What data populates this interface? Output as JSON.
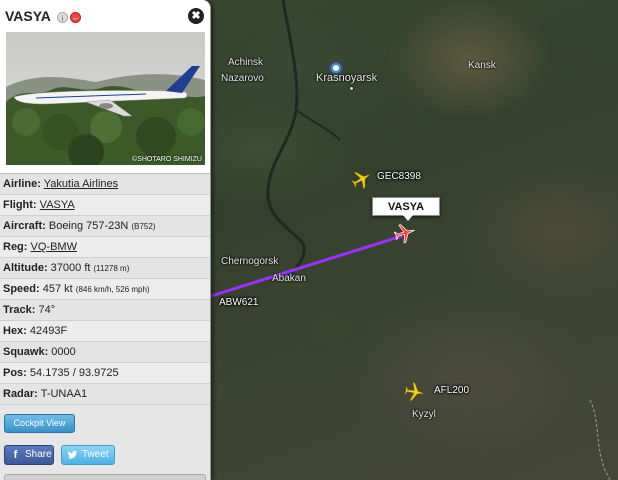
{
  "panel": {
    "title": "VASYA",
    "close_glyph": "✖",
    "info_glyph": "i",
    "remove_glyph": "–",
    "photo_credit": "©SHOTARO SHIMIZU",
    "rows": [
      {
        "label": "Airline:",
        "value": "Yakutia Airlines",
        "sub": "",
        "link": true
      },
      {
        "label": "Flight:",
        "value": "VASYA",
        "sub": "",
        "link": true
      },
      {
        "label": "Aircraft:",
        "value": "Boeing 757-23N",
        "sub": "(B752)",
        "link": false
      },
      {
        "label": "Reg:",
        "value": "VQ-BMW",
        "sub": "",
        "link": true
      },
      {
        "label": "Altitude:",
        "value": "37000 ft",
        "sub": "(11278 m)",
        "link": false
      },
      {
        "label": "Speed:",
        "value": "457 kt",
        "sub": "(846 km/h, 526 mph)",
        "link": false
      },
      {
        "label": "Track:",
        "value": "74°",
        "sub": "",
        "link": false
      },
      {
        "label": "Hex:",
        "value": "42493F",
        "sub": "",
        "link": false
      },
      {
        "label": "Squawk:",
        "value": "0000",
        "sub": "",
        "link": false
      },
      {
        "label": "Pos:",
        "value": "54.1735 / 93.9725",
        "sub": "",
        "link": false
      },
      {
        "label": "Radar:",
        "value": "T-UNAA1",
        "sub": "",
        "link": false
      }
    ],
    "cockpit_label": "Cockpit View",
    "facebook_label": "Share",
    "twitter_label": "Tweet"
  },
  "map": {
    "cities": {
      "achinsk": "Achinsk",
      "nazarovo": "Nazarovo",
      "krasnoyarsk": "Krasnoyarsk",
      "kansk": "Kansk",
      "chernogorsk": "Chernogorsk",
      "abakan": "Abakan",
      "kyzyl": "Kyzyl"
    },
    "flights": {
      "gec": "GEC8398",
      "abw": "ABW621",
      "afl": "AFL200",
      "selected": "VASYA"
    },
    "colors": {
      "track": "#9b30ff",
      "plane_yellow": "#f5d21c",
      "plane_selected": "#ff3b3b",
      "pin": "#3b8bff"
    }
  }
}
